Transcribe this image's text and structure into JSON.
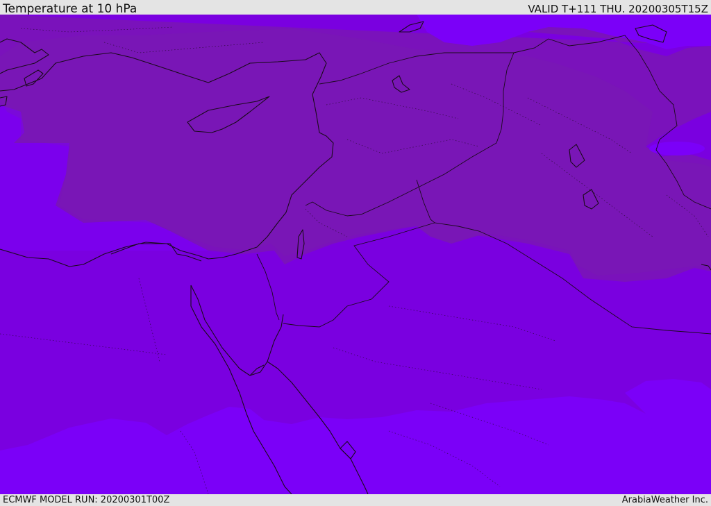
{
  "header": {
    "title": "Temperature at 10 hPa",
    "valid": "VALID T+111 THU. 20200305T15Z"
  },
  "footer": {
    "model_run": "ECMWF MODEL RUN: 20200301T00Z",
    "credit": "ArabiaWeather Inc."
  },
  "map": {
    "colors": {
      "band_dark": "#7a12bb",
      "band_mid": "#7a00e0",
      "band_light": "#7b00f8",
      "border": "#1a0a1a"
    }
  }
}
